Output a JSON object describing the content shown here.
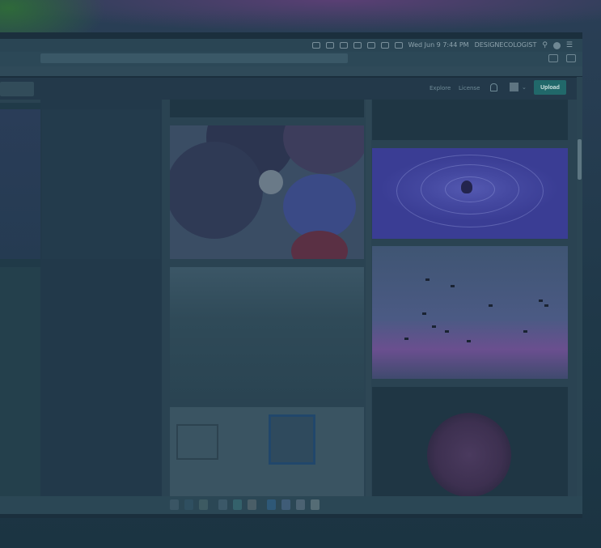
{
  "menubar": {
    "datetime": "Wed Jun 9  7:44 PM",
    "username": "DESIGNECOLOGIST"
  },
  "nav": {
    "explore_label": "Explore",
    "license_label": "License",
    "upload_label": "Upload"
  },
  "colors": {
    "accent": "#21686a",
    "background": "#1f3848"
  }
}
